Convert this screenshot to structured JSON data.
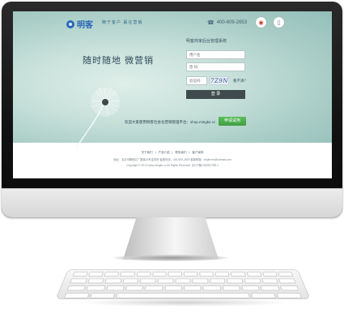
{
  "header": {
    "logo_text": "明客",
    "slogan": "精于客户  赢在营销",
    "phone": "400-609-2653",
    "phone_icon": "telephone-icon",
    "weibo_icon": "weibo-icon",
    "mobile_icon": "mobile-icon"
  },
  "hero": {
    "tagline": "随时随地  微营销"
  },
  "login": {
    "title": "明客商家后台管理系统",
    "username_placeholder": "用户名",
    "password_placeholder": "密 码",
    "captcha_placeholder": "验证码",
    "captcha_value": "7Z9N",
    "refresh_label": "看不清？",
    "submit_label": "登 录"
  },
  "promo": {
    "welcome": "欢迎大家使用明客社会化营销管理平台：shop.mingke.cc",
    "apply_label": "申请试用"
  },
  "footer": {
    "links": [
      "关于我们",
      "|",
      "产品介绍",
      "|",
      "联系我们",
      "|",
      "客户案例"
    ],
    "info": "地址：北京市朝阳区广渠路15号金茂府  客服热线：400-609-2653  客服邮箱：shijiecrm@hotmail.com",
    "copyright": "Copyright © 2013 www.mingke.cc All Rights Reserved.  京ICP备13009570号-1"
  },
  "colors": {
    "accent": "#2a69b8",
    "login_button": "#3f4b4c",
    "apply_button": "#4aaa4c"
  }
}
